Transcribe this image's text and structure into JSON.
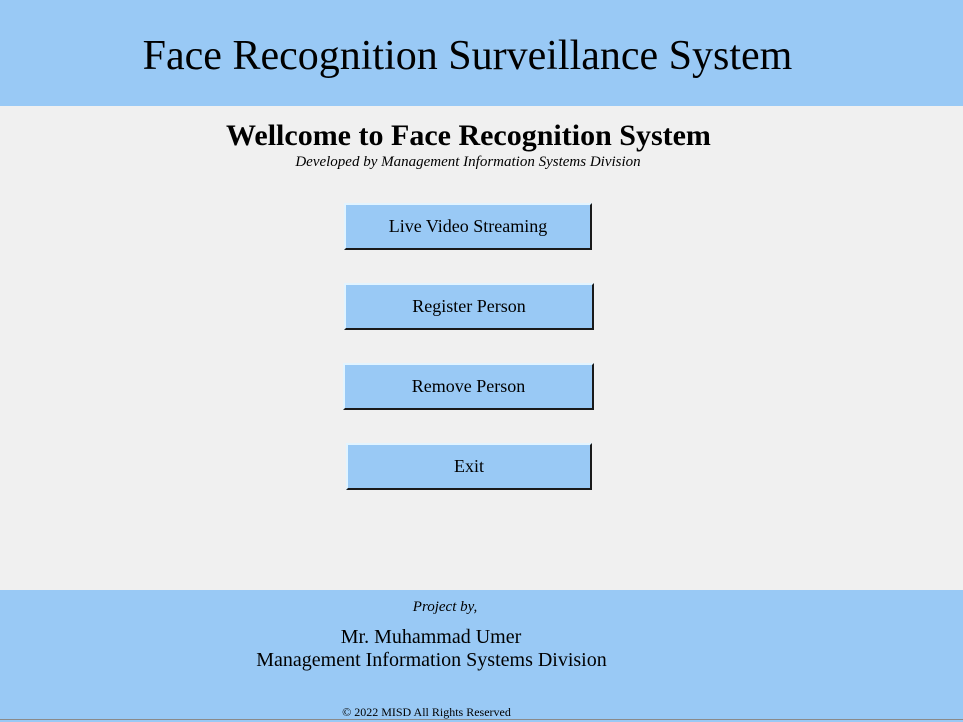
{
  "header": {
    "title": "Face Recognition Surveillance System"
  },
  "main": {
    "welcome": "Wellcome to Face Recognition System",
    "developed_by": "Developed by Management Information Systems Division",
    "buttons": {
      "live_video": "Live Video Streaming",
      "register": "Register Person",
      "remove": "Remove Person",
      "exit": "Exit"
    }
  },
  "footer": {
    "project_by": "Project by,",
    "author": "Mr. Muhammad Umer",
    "division": "Management Information Systems Division",
    "copyright": "© 2022 MISD All Rights Reserved"
  },
  "colors": {
    "panel": "#99c9f5",
    "background": "#f0f0f0"
  }
}
